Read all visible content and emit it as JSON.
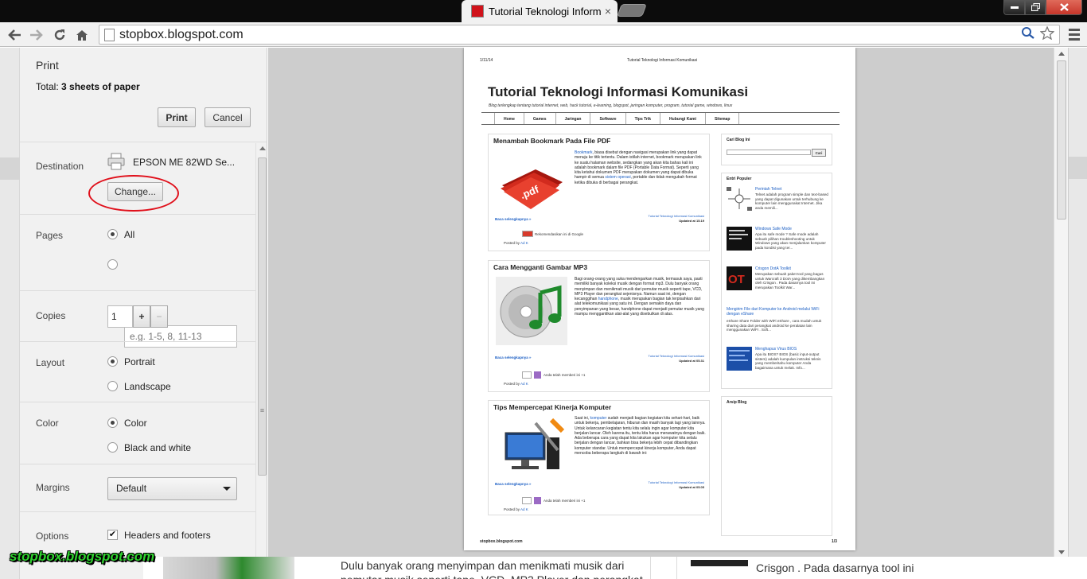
{
  "browser": {
    "tab_title": "Tutorial Teknologi Inform",
    "tab_close": "×",
    "url": "stopbox.blogspot.com"
  },
  "print_panel": {
    "title": "Print",
    "total_label": "Total: ",
    "total_value": "3 sheets of paper",
    "print_button": "Print",
    "cancel_button": "Cancel",
    "destination": {
      "label": "Destination",
      "printer": "EPSON ME 82WD Se...",
      "change_button": "Change..."
    },
    "pages": {
      "label": "Pages",
      "all": "All",
      "custom_placeholder": "e.g. 1-5, 8, 11-13"
    },
    "copies": {
      "label": "Copies",
      "value": "1",
      "plus": "+",
      "minus": "−"
    },
    "layout": {
      "label": "Layout",
      "portrait": "Portrait",
      "landscape": "Landscape"
    },
    "color": {
      "label": "Color",
      "color": "Color",
      "bw": "Black and white"
    },
    "margins": {
      "label": "Margins",
      "value": "Default"
    },
    "options": {
      "label": "Options",
      "headers_footers": "Headers and footers"
    }
  },
  "preview_page": {
    "header_date": "1/11/14",
    "header_title": "Tutorial Teknologi Informasi Komunikasi",
    "blog_title": "Tutorial Teknologi Informasi Komunikasi",
    "blog_desc": "Blog terlengkap tentang tutorial internet, web, hack tutorial, e-learning, blogspot, jaringan komputer, program, tutorial game, windows, linux",
    "nav": [
      "Home",
      "Games",
      "Jaringan",
      "Software",
      "Tips Trik",
      "Hubungi Kami",
      "Sitemap"
    ],
    "posts": [
      {
        "title": "Menambah Bookmark Pada File PDF",
        "body_link": "Bookmark",
        "body": ", biasa disebut dengan navigasi merupakan link yang dapat menuju ke titik tertentu. Dalam istilah internet, bookmark merupakan link ke suatu halaman website, sedangkan yang akan kita bahas kali ini adalah bookmark dalam file PDF (Portable Data Format). Seperti yang kita ketahui dokumen PDF merupakan dokumen yang dapat dibuka hampir di semua ",
        "body_link2": "sistem operasi",
        "body_end": ", portable dan tidak mengubah format ketika dibuka di berbagai perangkat.",
        "more": "Baca selengkapnya »",
        "category": "Tutorial Teknologi Informasi Komunikasi",
        "updated": "Updated at 15.19",
        "share": "Rekomendasikan ini di Google",
        "posted_by": "Posted by ",
        "author": "Ad K"
      },
      {
        "title": "Cara Mengganti Gambar MP3",
        "body": "Bagi orang-orang yang suka mendengarkan musik, termasuk saya, pasti memiliki banyak koleksi musik dengan format mp3. Dulu banyak orang menyimpan dan menikmati musik dari pemutar musik seperti tape, VCD, MP3 Player dan perangkat sejenisnya. Namun saat ini, dengan kecanggihan ",
        "body_link": "handphone",
        "body_end": ", musik merupakan bagian tak terpisahkan dari alat telekomunikasi yang satu ini. Dengan semakin daya dan penyimpanan yang besar, handphone dapat menjadi pemutar musik yang mampu menggantikan alat-alat yang disebutkan di atas.",
        "more": "Baca selengkapnya »",
        "category": "Tutorial Teknologi Informasi Komunikasi",
        "updated": "Updated at 05.31",
        "share": "Anda telah memberi ini +1",
        "posted_by": "Posted by ",
        "author": "Ad K"
      },
      {
        "title": "Tips Mempercepat Kinerja Komputer",
        "body": "Saat ini, ",
        "body_link": "komputer",
        "body_end": " sudah menjadi bagian kegiatan kita sehari-hari, baik untuk bekerja, pembelajaran, hiburan dan masih banyak lagi yang lainnya. Untuk kelancaran kegiatan tentu kita selalu ingin agar komputer kita berjalan lancar. Oleh karena itu, tentu kita harus merawatnya dengan baik. Ada beberapa cara yang dapat kita lakukan agar komputer kita selalu berjalan dengan lancar, bahkan bisa bekerja lebih cepat dibandingkan komputer standar. Untuk mempercepat kinerja komputer, Anda dapat mencoba beberapa langkah di bawah ini:",
        "more": "Baca selengkapnya »",
        "category": "Tutorial Teknologi Informasi Komunikasi",
        "updated": "Updated at 05.05",
        "share": "Anda telah memberi ini +1",
        "posted_by": "Posted by ",
        "author": "Ad K"
      }
    ],
    "sidebar": {
      "search_title": "Cari Blog Ini",
      "search_button": "Cari",
      "popular_title": "Entri Populer",
      "popular": [
        {
          "name": "Perintah Telnet",
          "desc": "Telnet adalah program simple dan text-based yang dapat digunakan untuk terhubung ke komputer lain menggunakat Internet. Jika anda memili..."
        },
        {
          "name": "Windows Safe Mode",
          "desc": "Apa itu safe mode ? Safe mode adalah sebuah pilihan troubleshooting untuk Windows yang akan menjalankan komputer pada kondisi yang ter..."
        },
        {
          "name": "Crisgon DotA Toolkit",
          "desc": "Merupakan sebuah paket tool yang bagus untuk Warcraft 3 DotA yang dikembangkan oleh Crisgon . Pada dasarnya tool ini merupakan Toolkit War..."
        },
        {
          "name": "Mengirim File dari Komputer ke Android melalui WiFi dengan eShare",
          "desc": "eShare Share Folder with WiFi eShare , cara mudah untuk sharing data dari perangkat android ke peralatan lain menggunakan WIFI . Soft..."
        },
        {
          "name": "Menghapus Virus BIOS",
          "desc": "Apa itu BIOS? BIOS (basic input-output sistem) adalah kumpulan instruksi teknis yang memberitahu komputer Anda bagaimana untuk melak. Info..."
        }
      ],
      "archive_title": "Arsip Blog"
    },
    "footer_url": "stopbox.blogspot.com",
    "footer_page": "1/3"
  },
  "background": {
    "text1_line1": "Dulu banyak orang menyimpan dan menikmati musik dari",
    "text1_line2": "pemutar musik seperti tape, VCD, MP3 Player dan perangkat",
    "text2": "Crisgon . Pada dasarnya tool ini"
  },
  "watermark": "stopbox.blogspot.com",
  "colors": {
    "accent_link": "#1c5fc4",
    "highlight_circle": "#e0101b",
    "watermark": "#2fd12f"
  }
}
